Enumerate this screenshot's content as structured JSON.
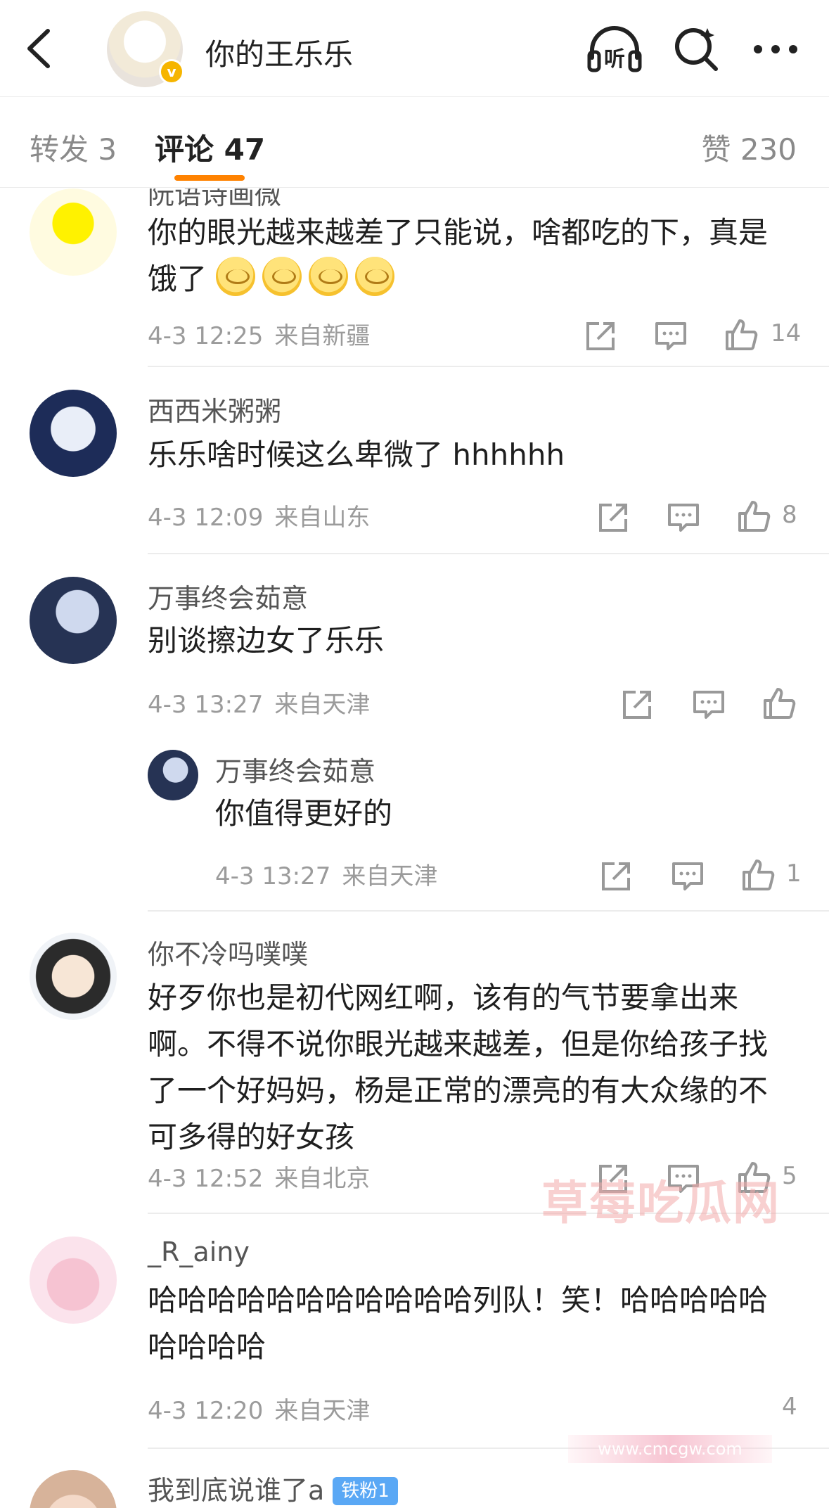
{
  "header": {
    "title": "你的王乐乐",
    "back_icon": "chevron-left-icon",
    "listen_label": "听",
    "verified_badge": "v"
  },
  "tabs": {
    "repost": "转发 3",
    "comments": "评论 47",
    "likes": "赞 230",
    "accent_color": "#ff8200"
  },
  "comments": [
    {
      "username": "阮语诗画微",
      "text": "你的眼光越来越差了只能说，啥都吃的下，真是饿了",
      "emoji_count": 4,
      "time": "4-3 12:25",
      "location": "来自新疆",
      "likes": "14"
    },
    {
      "username": "西西米粥粥",
      "text": "乐乐啥时候这么卑微了 hhhhhh",
      "time": "4-3 12:09",
      "location": "来自山东",
      "likes": "8"
    },
    {
      "username": "万事终会茹意",
      "text": "别谈擦边女了乐乐",
      "time": "4-3 13:27",
      "location": "来自天津",
      "likes": "",
      "reply": {
        "username": "万事终会茹意",
        "text": "你值得更好的",
        "time": "4-3 13:27",
        "location": "来自天津",
        "likes": "1"
      }
    },
    {
      "username": "你不冷吗噗噗",
      "text": "好歹你也是初代网红啊，该有的气节要拿出来啊。不得不说你眼光越来越差，但是你给孩子找了一个好妈妈，杨是正常的漂亮的有大众缘的不可多得的好女孩",
      "time": "4-3 12:52",
      "location": "来自北京",
      "likes": "5"
    },
    {
      "username": "_R_ainy",
      "text": "哈哈哈哈哈哈哈哈哈哈哈列队！笑！哈哈哈哈哈哈哈哈哈",
      "time": "4-3 12:20",
      "location": "来自天津",
      "likes": "4"
    },
    {
      "username": "我到底说谁了a",
      "badge": "铁粉1"
    }
  ],
  "watermark": {
    "text": "草莓吃瓜网",
    "url": "www.cmcgw.com"
  }
}
